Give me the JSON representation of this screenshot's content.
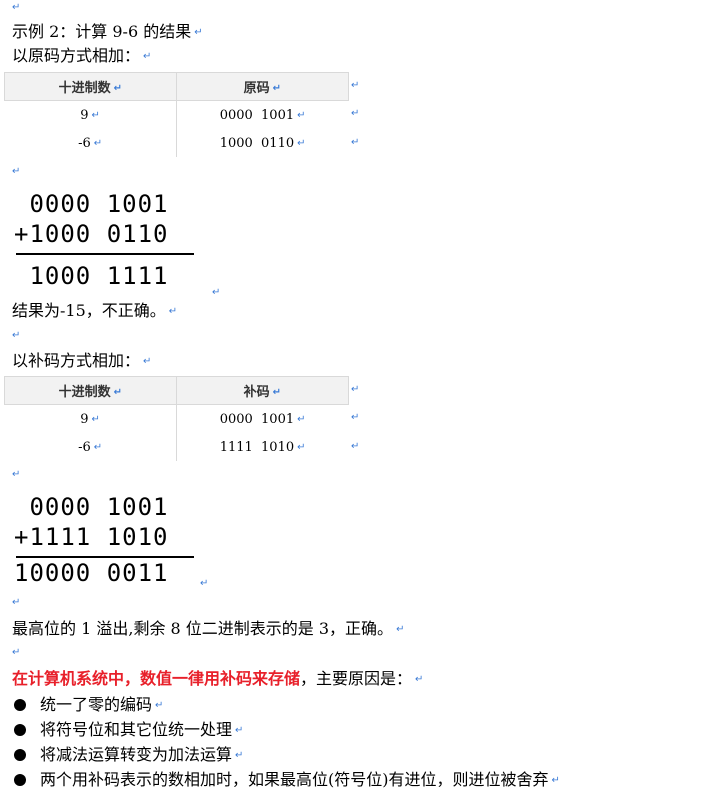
{
  "mark": "↵",
  "title": "示例 2：计算 9-6 的结果",
  "section1": {
    "heading": "以原码方式相加：",
    "table": {
      "headers": [
        "十进制数",
        "原码"
      ],
      "rows": [
        [
          "9",
          "0000  1001"
        ],
        [
          "-6",
          "1000  0110"
        ]
      ]
    },
    "addend_a": " 0000 1001",
    "addend_b": "+1000 0110",
    "sum": " 1000 1111",
    "conclusion": "结果为-15，不正确。"
  },
  "section2": {
    "heading": "以补码方式相加：",
    "table": {
      "headers": [
        "十进制数",
        "补码"
      ],
      "rows": [
        [
          "9",
          "0000  1001"
        ],
        [
          "-6",
          "1111  1010"
        ]
      ]
    },
    "addend_a": " 0000 1001",
    "addend_b": "+1111 1010",
    "sum": "10000 0011",
    "conclusion": "最高位的 1 溢出,剩余 8 位二进制表示的是 3，正确。"
  },
  "summary": {
    "emphasis": "在计算机系统中，数值一律用补码来存储",
    "rest": "，主要原因是：",
    "bullets": [
      "统一了零的编码",
      "将符号位和其它位统一处理",
      "将减法运算转变为加法运算",
      "两个用补码表示的数相加时，如果最高位(符号位)有进位，则进位被舍弃"
    ]
  }
}
